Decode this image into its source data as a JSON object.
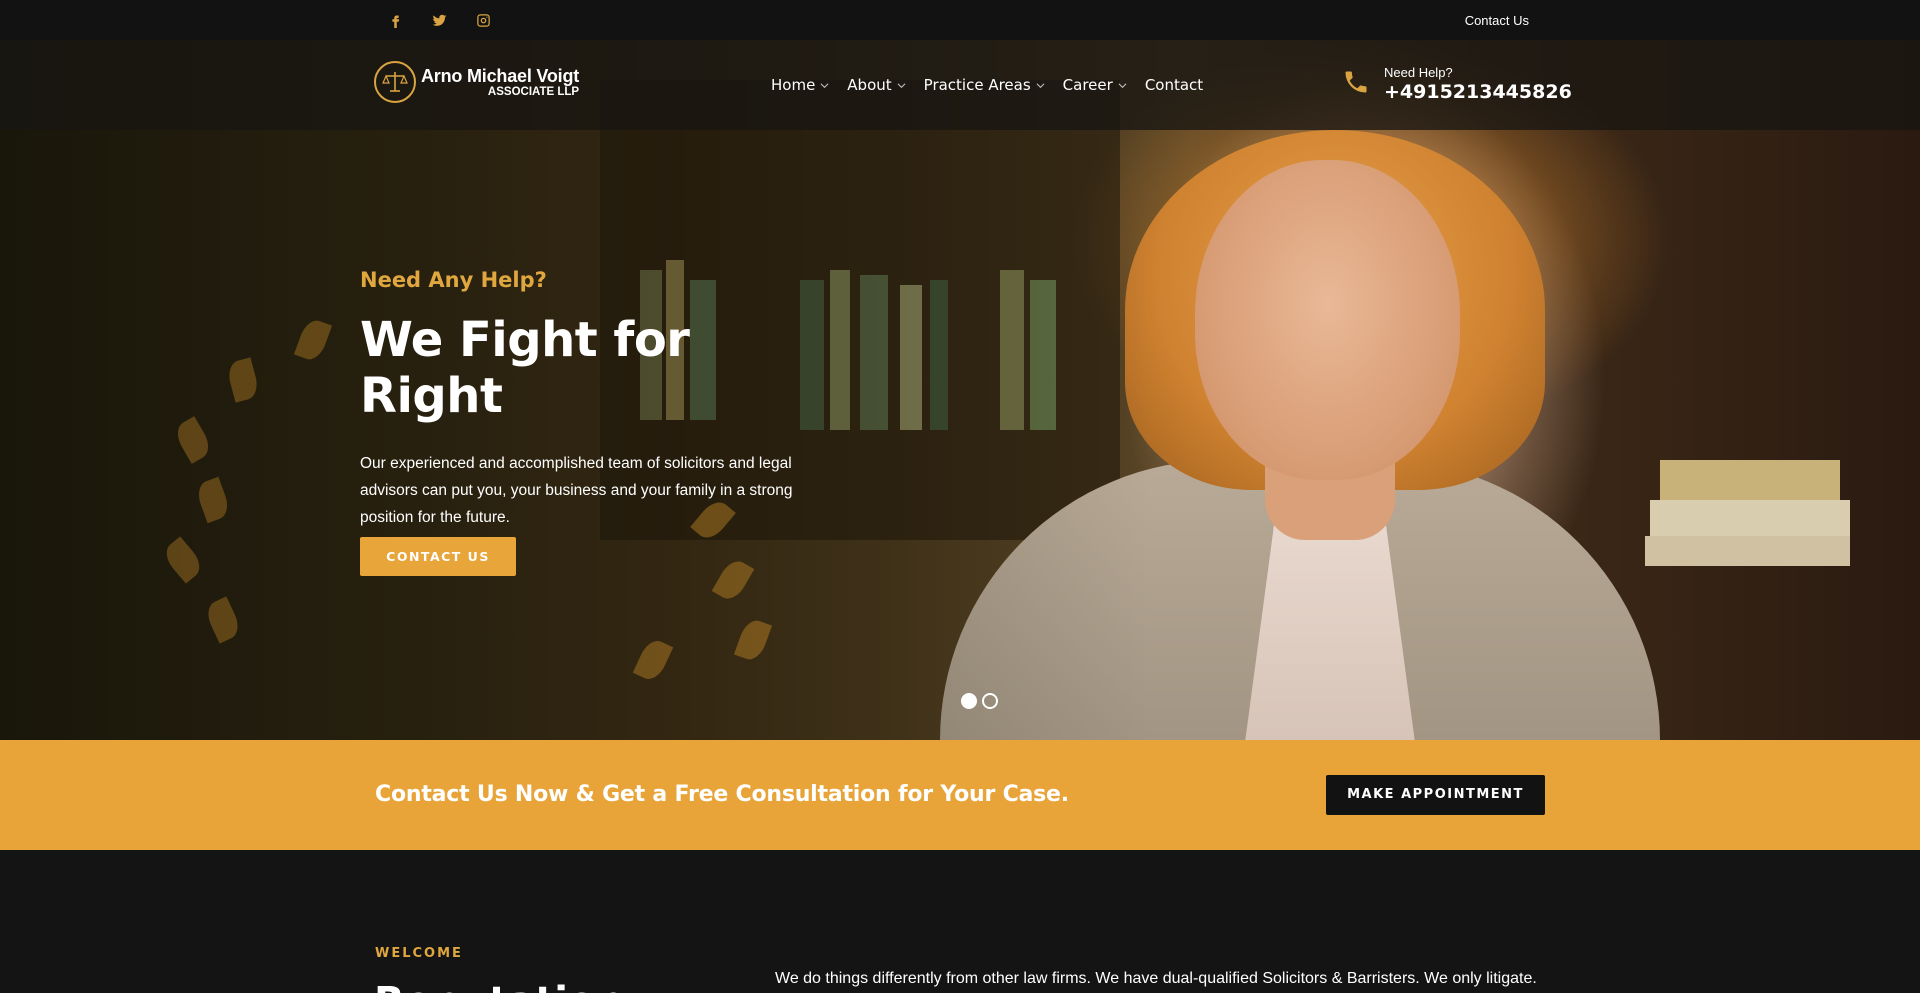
{
  "topbar": {
    "social": [
      {
        "icon": "facebook-icon"
      },
      {
        "icon": "twitter-icon"
      },
      {
        "icon": "instagram-icon"
      }
    ],
    "contact_link": "Contact Us"
  },
  "header": {
    "logo": {
      "name": "Arno Michael Voigt",
      "sub": "ASSOCIATE LLP",
      "icon": "scales-of-justice-icon"
    },
    "nav": [
      {
        "label": "Home",
        "has_dropdown": true
      },
      {
        "label": "About",
        "has_dropdown": true
      },
      {
        "label": "Practice Areas",
        "has_dropdown": true
      },
      {
        "label": "Career",
        "has_dropdown": true
      },
      {
        "label": "Contact",
        "has_dropdown": false
      }
    ],
    "help": {
      "label": "Need Help?",
      "phone": "+4915213445826",
      "icon": "phone-icon"
    }
  },
  "hero": {
    "kicker": "Need Any Help?",
    "headline": "We Fight for Right",
    "lead": "Our experienced and accomplished team of solicitors and legal advisors can put you, your business and your family in a strong position for the future.",
    "button": "CONTACT US",
    "slides": {
      "count": 2,
      "active": 1
    }
  },
  "cta": {
    "text": "Contact Us Now & Get a Free Consultation for Your Case.",
    "button": "MAKE APPOINTMENT"
  },
  "welcome": {
    "eyebrow": "WELCOME",
    "title": "Reputation",
    "intro": "We do things differently from other law firms. We have dual-qualified Solicitors & Barristers. We only litigate. So"
  },
  "colors": {
    "accent": "#e8a438",
    "dark": "#121212",
    "text": "#ffffff"
  }
}
